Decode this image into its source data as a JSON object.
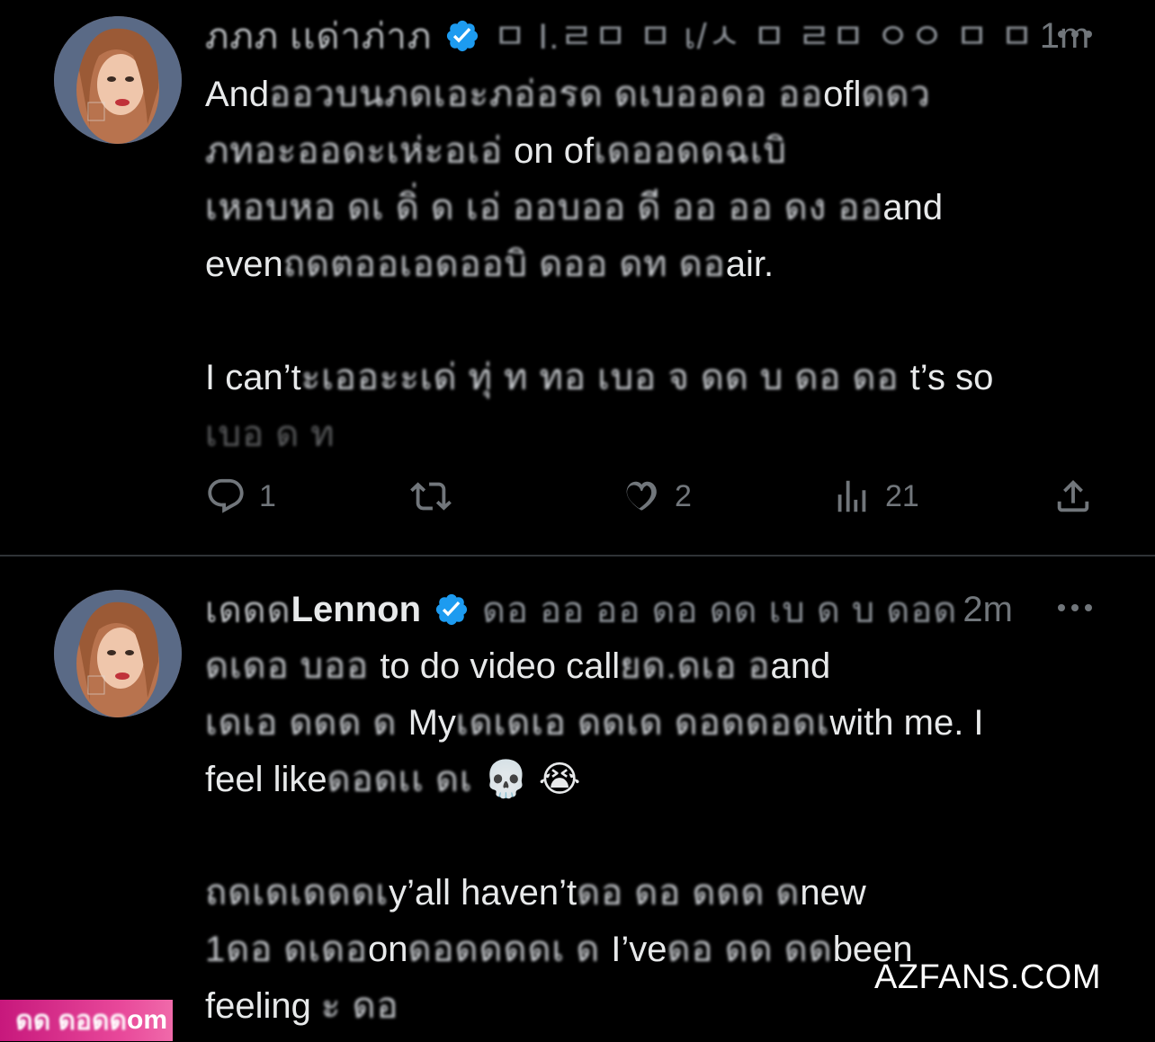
{
  "colors": {
    "background": "#000000",
    "text_primary": "#e7e9ea",
    "text_secondary": "#71767b",
    "verified_blue": "#1d9bf0",
    "divider": "#2f3336"
  },
  "tweets": [
    {
      "display_name": "ภภภ เเด่าภ่าภ",
      "verified": true,
      "handle": "ㅁ I.ㄹㅁ ㅁ เ/ㅅ ㅁ ㄹㅁ ㅇㅇ ㅁ ㅁ",
      "time": "1m",
      "more_icon": "ellipsis-icon",
      "lines": [
        [
          {
            "t": "And",
            "b": false
          },
          {
            "t": "ออวบนภดเอะภอ่อรด ดเบออดอ ออ",
            "b": true
          },
          {
            "t": "ofl",
            "b": false
          },
          {
            "t": "ดดว",
            "b": true
          }
        ],
        [
          {
            "t": "ภทอะออดะเห่ะอเอ่ ",
            "b": true
          },
          {
            "t": "on of",
            "b": false
          },
          {
            "t": "เดออดดฉเบิ",
            "b": true
          }
        ],
        [
          {
            "t": "เหอบหอ ดเ ดิ่ ด เอ่ ออบออ ดี ออ ออ ดง ออ",
            "b": true
          },
          {
            "t": "and",
            "b": false
          }
        ],
        [
          {
            "t": "even",
            "b": false
          },
          {
            "t": "ถดตออเอดออบิ ดออ ดท ดอ",
            "b": true
          },
          {
            "t": "air.",
            "b": false
          }
        ],
        [],
        [
          {
            "t": "I can’t",
            "b": false
          },
          {
            "t": "ะเออะะเด่ ทุ่ ท ทอ เบอ จ ดด บ ดอ ดอ ",
            "b": true
          },
          {
            "t": "t’s so",
            "b": false
          }
        ],
        [
          {
            "t": "เบอ ด ท",
            "b": true,
            "fade": true
          }
        ]
      ],
      "reply_count": "1",
      "repost_count": "",
      "like_count": "2",
      "view_count": "21"
    },
    {
      "display_name": "Lennon",
      "name_prefix": "เดดด",
      "verified": true,
      "handle": "ดอ ออ ออ ดอ ดด เบ ด บ ดอด",
      "time": "2m",
      "more_icon": "ellipsis-icon",
      "lines": [
        [
          {
            "t": "ดเดอ บออ ",
            "b": true
          },
          {
            "t": "to do video call",
            "b": false
          },
          {
            "t": "ยด.ดเอ อ",
            "b": true
          },
          {
            "t": "and",
            "b": false
          }
        ],
        [
          {
            "t": "เดเอ ดดด ด ",
            "b": true
          },
          {
            "t": "My",
            "b": false
          },
          {
            "t": "เดเดเอ ดดเด ดอดดอดเ",
            "b": true
          },
          {
            "t": "with me. I",
            "b": false
          }
        ],
        [
          {
            "t": "feel like",
            "b": false
          },
          {
            "t": "ดอดเเ ดเ ",
            "b": true
          },
          {
            "t": "💀 😭",
            "b": false
          }
        ],
        [],
        [
          {
            "t": "ถดเดเดดดเ",
            "b": true
          },
          {
            "t": "y’all haven’t",
            "b": false
          },
          {
            "t": "ดอ ดอ ดดด ด",
            "b": true
          },
          {
            "t": "new",
            "b": false
          }
        ],
        [
          {
            "t": "1ดอ ดเดอ",
            "b": true
          },
          {
            "t": "on",
            "b": false
          },
          {
            "t": "ดอดดดดเ ด ",
            "b": true
          },
          {
            "t": "I’ve",
            "b": false
          },
          {
            "t": "ดอ ดด ดด",
            "b": true
          },
          {
            "t": "been",
            "b": false
          }
        ],
        [
          {
            "t": "feeling ",
            "b": false
          },
          {
            "t": "ะ ดอ",
            "b": true
          }
        ]
      ]
    }
  ],
  "watermark": "AZFANS.COM",
  "badge": {
    "blurred": "ดด ดอดด",
    "suffix": "om"
  }
}
